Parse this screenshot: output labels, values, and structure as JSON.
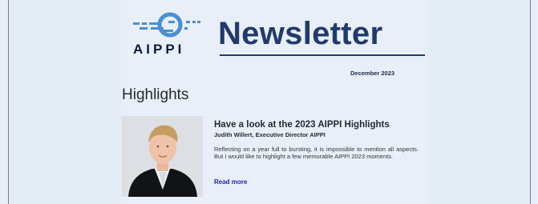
{
  "header": {
    "logo_text": "AIPPI",
    "title": "Newsletter",
    "date": "December 2023"
  },
  "section": {
    "heading": "Highlights"
  },
  "article": {
    "title": "Have a look at the 2023 AIPPI Highlights",
    "author": "Judith Willert, Executive Director AIPPI",
    "summary": "Reflecting on a year full to bursting, it is impossible to mention all aspects. But I would like to highlight a few memorable AIPPI 2023 moments.",
    "read_more": "Read more"
  },
  "colors": {
    "brand_navy": "#213a6e",
    "logo_blue": "#4a8fd6",
    "link": "#1c1fb2",
    "background": "#e4ecf6"
  }
}
